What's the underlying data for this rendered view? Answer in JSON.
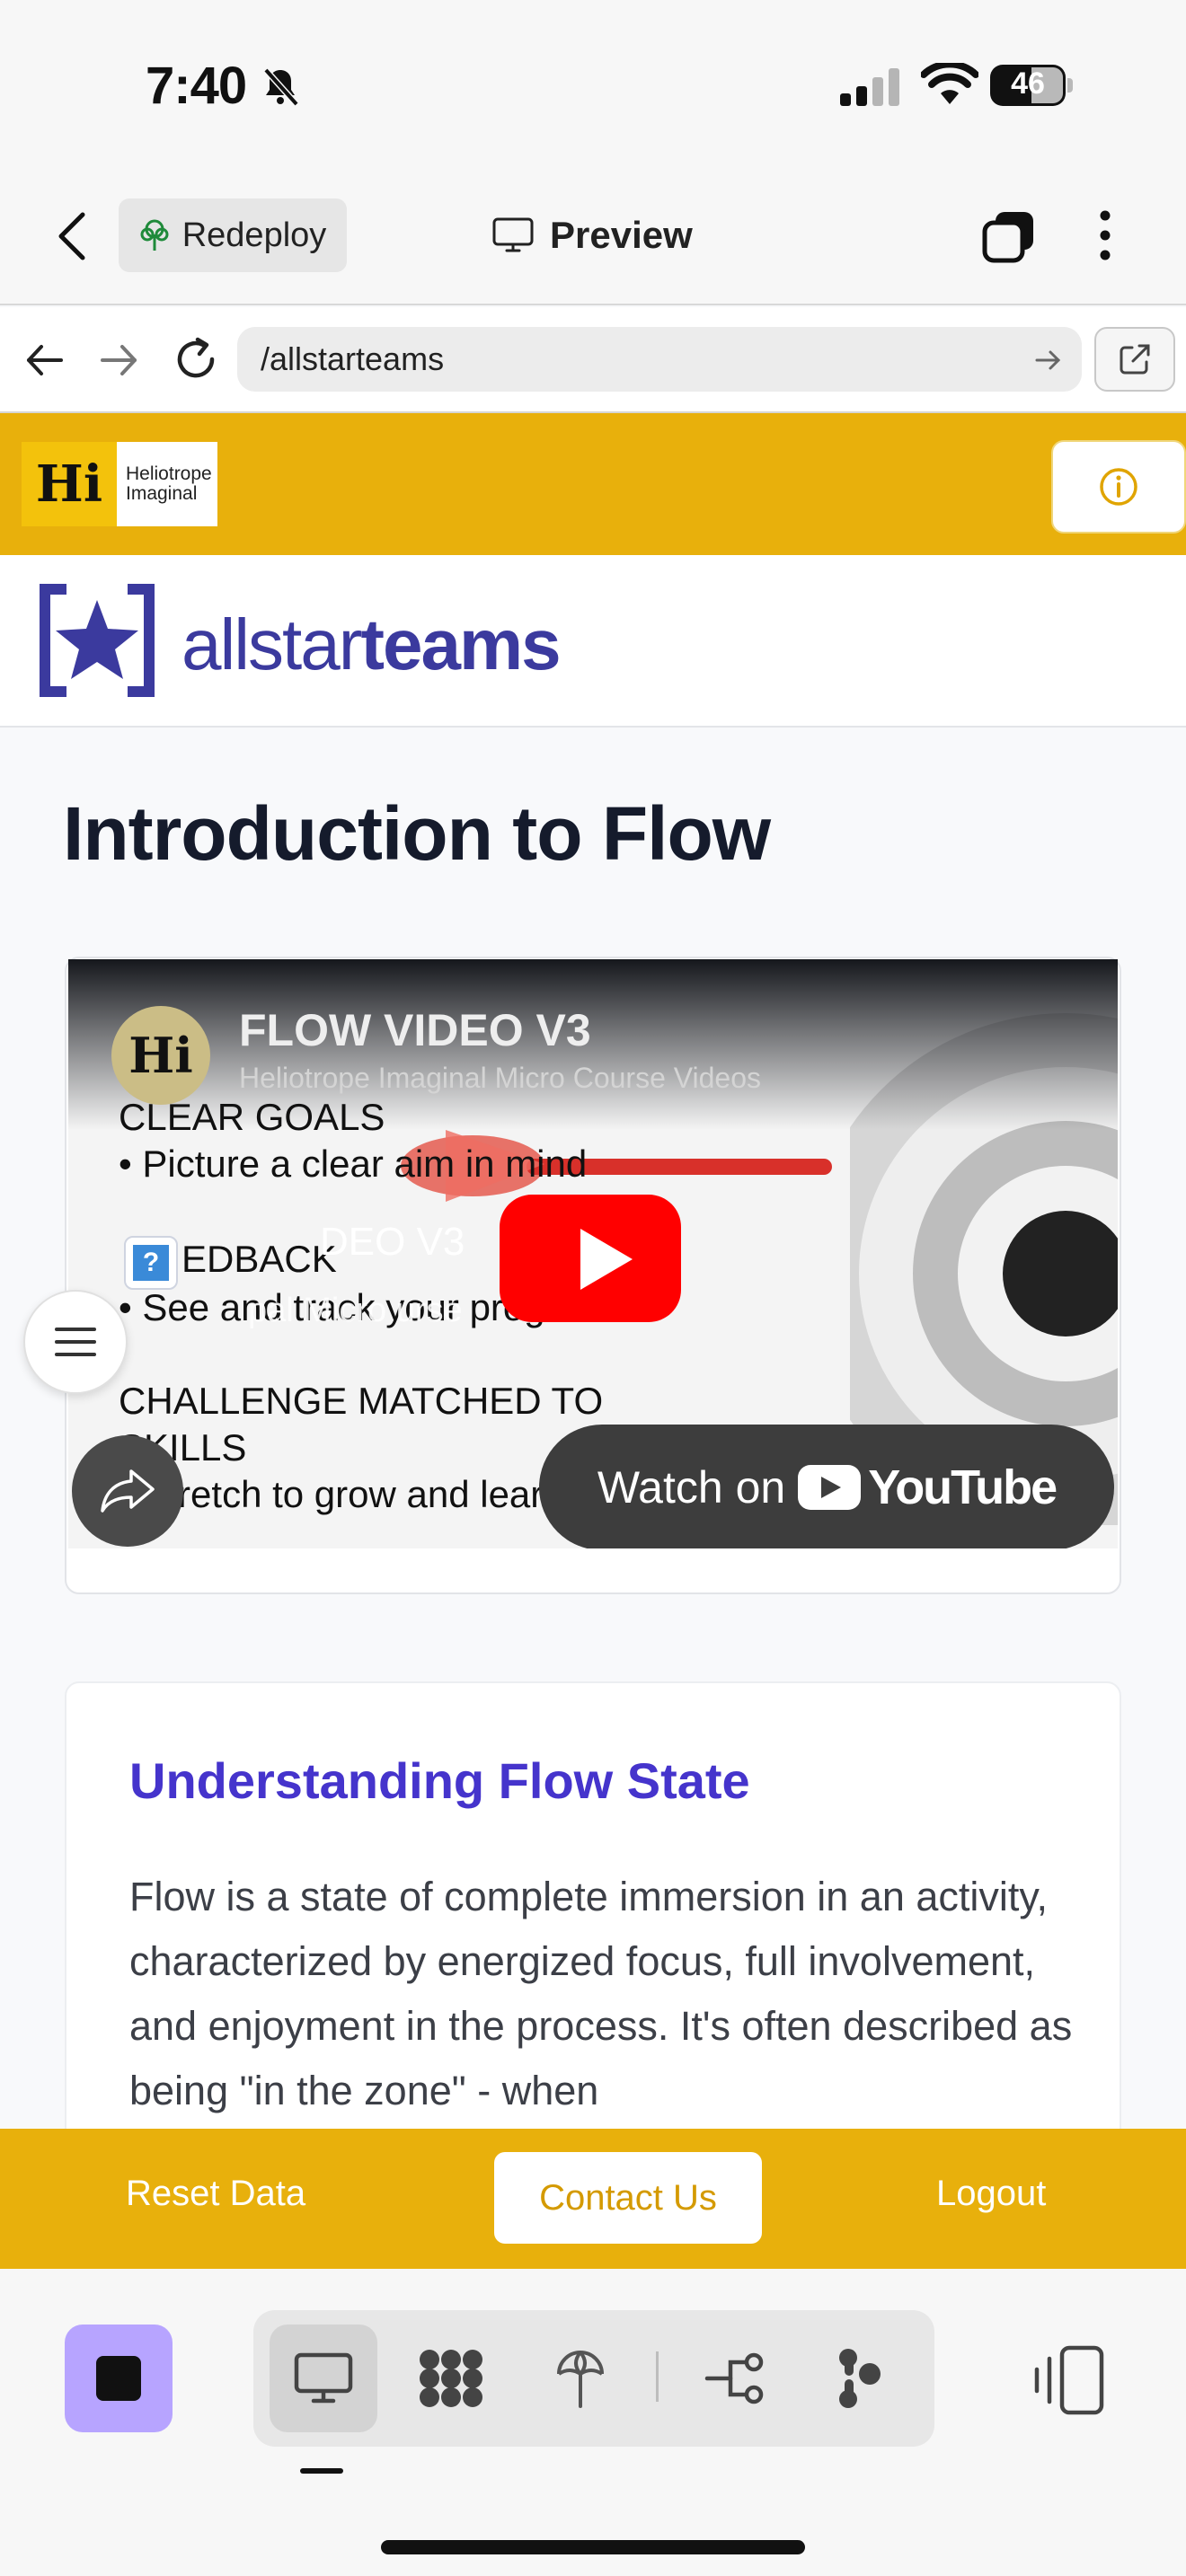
{
  "status_bar": {
    "time": "7:40",
    "battery": "46"
  },
  "app_toolbar": {
    "redeploy_label": "Redeploy",
    "preview_label": "Preview"
  },
  "browser": {
    "url": "/allstarteams"
  },
  "site_header": {
    "logo_mark": "Hi",
    "logo_line1": "Heliotrope",
    "logo_line2": "Imaginal"
  },
  "brand": {
    "word_light": "allstar",
    "word_bold": "teams"
  },
  "page": {
    "title": "Introduction to Flow"
  },
  "video": {
    "title": "FLOW VIDEO V3",
    "channel": "Heliotrope Imaginal Micro Course Videos",
    "avatar_mark": "Hi",
    "slide_lines": [
      "CLEAR GOALS",
      "•  Picture a clear aim in mind",
      "EDBACK",
      "•  See and track your progress",
      "CHALLENGE MATCHED TO",
      "SKILLS",
      "•  Stretch to grow and learn"
    ],
    "overlay_title": "DEO V3",
    "overlay_sub": "pal Micro  urse",
    "watch_label": "Watch on",
    "youtube_label": "YouTube"
  },
  "info_card": {
    "heading": "Understanding Flow State",
    "body": "Flow is a state of complete immersion in an activity, characterized by energized focus, full involvement, and enjoyment in the process. It's often described as being \"in the zone\" - when"
  },
  "footer": {
    "reset_label": "Reset Data",
    "contact_label": "Contact Us",
    "logout_label": "Logout"
  },
  "colors": {
    "header_yellow": "#e8b00c",
    "brand_indigo": "#3b3a9e",
    "heading_purple": "#4534cc",
    "stop_button": "#b7a4ff",
    "youtube_red": "#ff0000"
  },
  "icons": [
    "bell-muted-icon",
    "signal-icon",
    "wifi-icon",
    "battery-icon",
    "chevron-left-icon",
    "tree-icon",
    "monitor-icon",
    "tabs-icon",
    "kebab-icon",
    "arrow-left-icon",
    "arrow-right-icon",
    "reload-icon",
    "external-link-icon",
    "info-icon",
    "star-icon",
    "play-icon",
    "share-icon",
    "hamburger-icon",
    "stop-icon",
    "desktop-icon",
    "grid-icon",
    "deploy-icon",
    "branch-icon",
    "agent-icon",
    "rotate-icon"
  ]
}
